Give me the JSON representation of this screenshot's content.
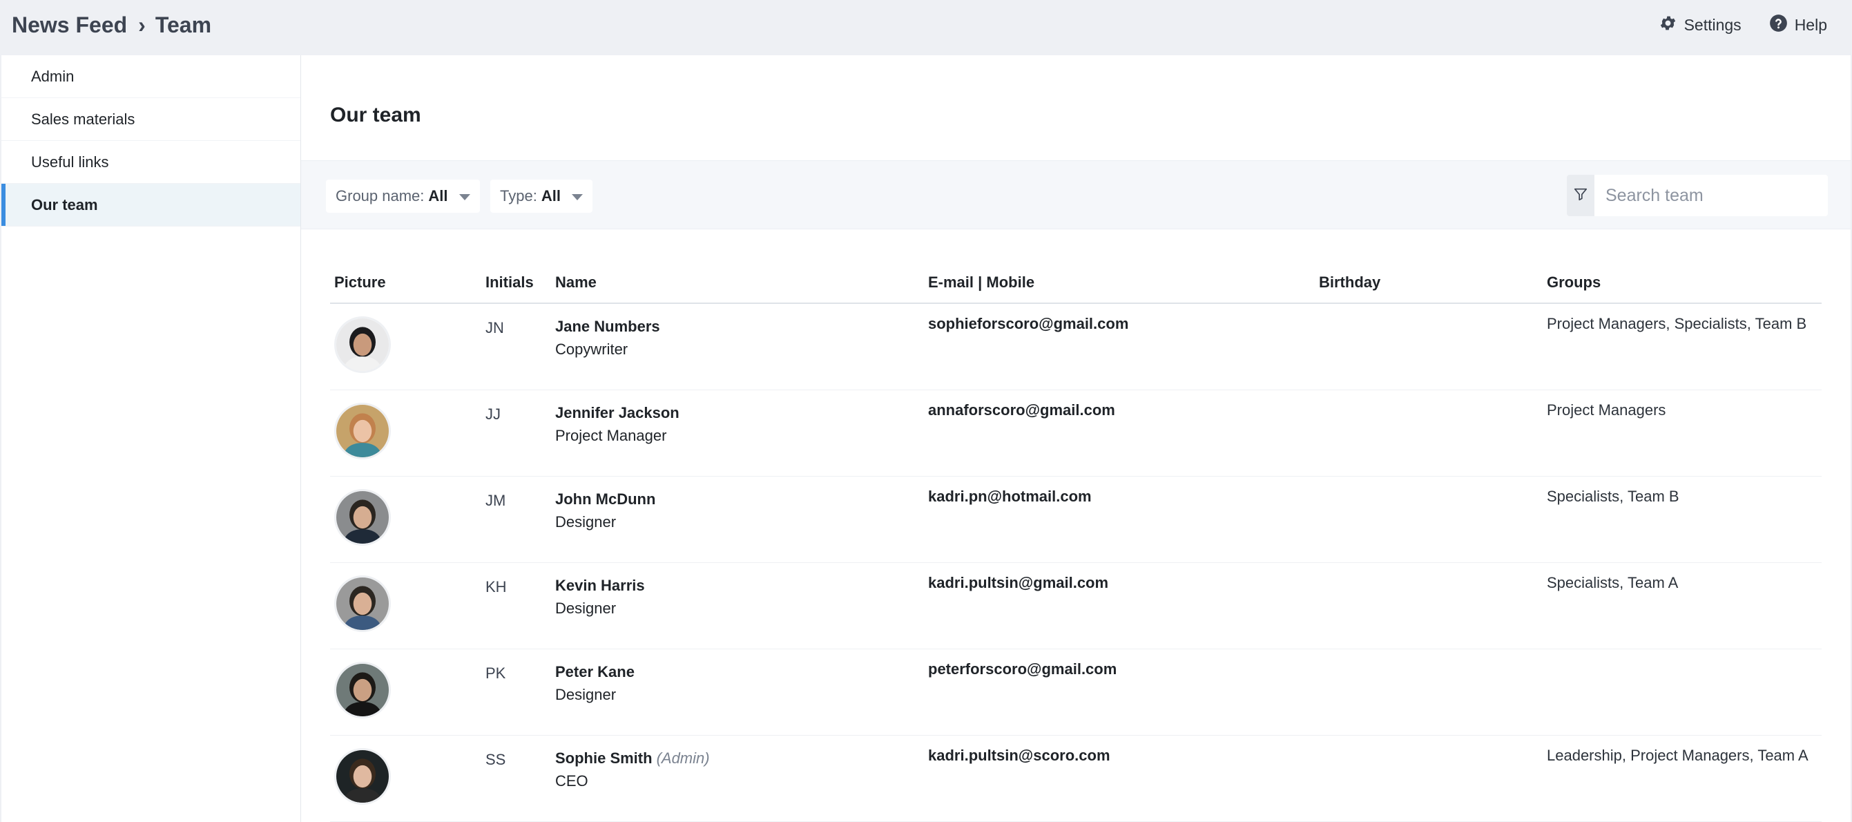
{
  "breadcrumb": {
    "parent": "News Feed",
    "separator": "›",
    "current": "Team"
  },
  "topbar": {
    "settings_label": "Settings",
    "help_label": "Help"
  },
  "sidebar": {
    "items": [
      {
        "label": "Admin",
        "active": false
      },
      {
        "label": "Sales materials",
        "active": false
      },
      {
        "label": "Useful links",
        "active": false
      },
      {
        "label": "Our team",
        "active": true
      }
    ]
  },
  "main": {
    "title": "Our team",
    "filters": {
      "group": {
        "label": "Group name:",
        "value": "All"
      },
      "type": {
        "label": "Type:",
        "value": "All"
      }
    },
    "search": {
      "placeholder": "Search team",
      "value": ""
    },
    "columns": {
      "picture": "Picture",
      "initials": "Initials",
      "name": "Name",
      "email": "E-mail | Mobile",
      "birthday": "Birthday",
      "groups": "Groups"
    },
    "rows": [
      {
        "initials": "JN",
        "name": "Jane Numbers",
        "admin": "",
        "role": "Copywriter",
        "email": "sophieforscoro@gmail.com",
        "birthday": "",
        "groups": "Project Managers, Specialists, Team B",
        "avatar": {
          "bg": "#e9e9ea",
          "hair": "#1b1b1d",
          "skin": "#c99a7c",
          "shirt": "#f2f2f2"
        }
      },
      {
        "initials": "JJ",
        "name": "Jennifer Jackson",
        "admin": "",
        "role": "Project Manager",
        "email": "annaforscoro@gmail.com",
        "birthday": "",
        "groups": "Project Managers",
        "avatar": {
          "bg": "#c6a36a",
          "hair": "#c1814d",
          "skin": "#ecc3a6",
          "shirt": "#3d8a9a"
        }
      },
      {
        "initials": "JM",
        "name": "John McDunn",
        "admin": "",
        "role": "Designer",
        "email": "kadri.pn@hotmail.com",
        "birthday": "",
        "groups": "Specialists, Team B",
        "avatar": {
          "bg": "#8a8c8e",
          "hair": "#2a2520",
          "skin": "#d6ad91",
          "shirt": "#1f2a38"
        }
      },
      {
        "initials": "KH",
        "name": "Kevin Harris",
        "admin": "",
        "role": "Designer",
        "email": "kadri.pultsin@gmail.com",
        "birthday": "",
        "groups": "Specialists, Team A",
        "avatar": {
          "bg": "#9a9a9a",
          "hair": "#2b2621",
          "skin": "#d9b095",
          "shirt": "#3c5a80"
        }
      },
      {
        "initials": "PK",
        "name": "Peter Kane",
        "admin": "",
        "role": "Designer",
        "email": "peterforscoro@gmail.com",
        "birthday": "",
        "groups": "",
        "avatar": {
          "bg": "#6f7a78",
          "hair": "#1d1a17",
          "skin": "#caa083",
          "shirt": "#151515"
        }
      },
      {
        "initials": "SS",
        "name": "Sophie Smith",
        "admin": "(Admin)",
        "role": "CEO",
        "email": "kadri.pultsin@scoro.com",
        "birthday": "",
        "groups": "Leadership, Project Managers, Team A",
        "avatar": {
          "bg": "#1e2426",
          "hair": "#3a2a1d",
          "skin": "#e0b9a0",
          "shirt": "#2a2a2a"
        }
      }
    ]
  },
  "colors": {
    "accent": "#3b8de0",
    "active_bg": "#edf4f8",
    "topbar_bg": "#eef0f4"
  },
  "icons": {
    "settings": "gear-icon",
    "help": "help-icon",
    "filter": "filter-icon"
  }
}
